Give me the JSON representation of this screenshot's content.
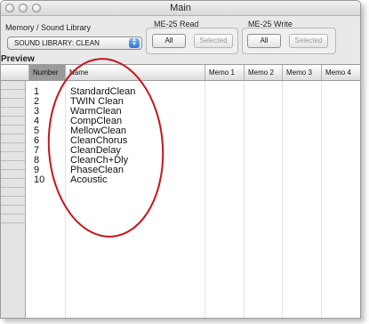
{
  "window": {
    "title": "Main"
  },
  "memory": {
    "label": "Memory / Sound Library",
    "selected": "SOUND LIBRARY: CLEAN"
  },
  "read": {
    "label": "ME-25 Read",
    "all": "All",
    "selected": "Selected"
  },
  "write": {
    "label": "ME-25 Write",
    "all": "All",
    "selected": "Selected"
  },
  "preview": {
    "label": "Preview"
  },
  "table": {
    "headers": [
      "Number",
      "Name",
      "Memo 1",
      "Memo 2",
      "Memo 3",
      "Memo 4"
    ],
    "rows": [
      {
        "num": "1",
        "name": "StandardClean"
      },
      {
        "num": "2",
        "name": "TWIN Clean"
      },
      {
        "num": "3",
        "name": "WarmClean"
      },
      {
        "num": "4",
        "name": "CompClean"
      },
      {
        "num": "5",
        "name": "MellowClean"
      },
      {
        "num": "6",
        "name": "CleanChorus"
      },
      {
        "num": "7",
        "name": "CleanDelay"
      },
      {
        "num": "8",
        "name": "CleanCh+Dly"
      },
      {
        "num": "9",
        "name": "PhaseClean"
      },
      {
        "num": "10",
        "name": "Acoustic"
      }
    ]
  },
  "annotation": {
    "color": "#c8141c"
  }
}
